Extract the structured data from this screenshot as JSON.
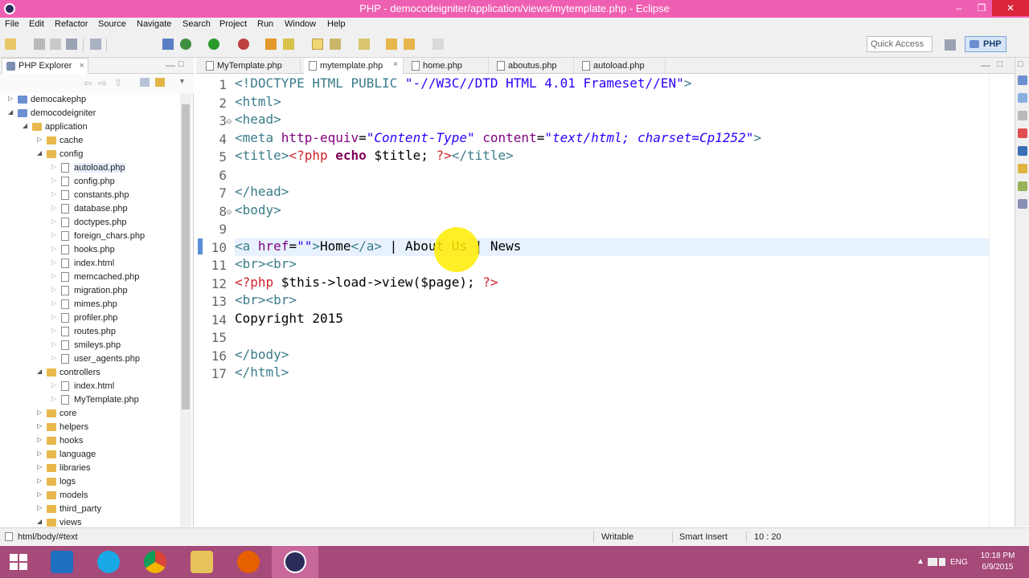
{
  "window": {
    "title": "PHP - democodeigniter/application/views/mytemplate.php - Eclipse"
  },
  "menu": [
    "File",
    "Edit",
    "Refactor",
    "Source",
    "Navigate",
    "Search",
    "Project",
    "Run",
    "Window",
    "Help"
  ],
  "toolbar": {
    "quick_access_placeholder": "Quick Access",
    "perspective": "PHP"
  },
  "explorer": {
    "tab_label": "PHP Explorer",
    "tree": [
      {
        "label": "democakephp",
        "type": "project",
        "depth": 0,
        "expanded": false
      },
      {
        "label": "democodeigniter",
        "type": "project",
        "depth": 0,
        "expanded": true
      },
      {
        "label": "application",
        "type": "folder",
        "depth": 1,
        "expanded": true
      },
      {
        "label": "cache",
        "type": "folder",
        "depth": 2,
        "expanded": false
      },
      {
        "label": "config",
        "type": "folder",
        "depth": 2,
        "expanded": true
      },
      {
        "label": "autoload.php",
        "type": "file",
        "depth": 3,
        "expanded": false
      },
      {
        "label": "config.php",
        "type": "file",
        "depth": 3,
        "expanded": false
      },
      {
        "label": "constants.php",
        "type": "file",
        "depth": 3,
        "expanded": false
      },
      {
        "label": "database.php",
        "type": "file",
        "depth": 3,
        "expanded": false
      },
      {
        "label": "doctypes.php",
        "type": "file",
        "depth": 3,
        "expanded": false
      },
      {
        "label": "foreign_chars.php",
        "type": "file",
        "depth": 3,
        "expanded": false
      },
      {
        "label": "hooks.php",
        "type": "file",
        "depth": 3,
        "expanded": false
      },
      {
        "label": "index.html",
        "type": "file",
        "depth": 3,
        "expanded": false
      },
      {
        "label": "memcached.php",
        "type": "file",
        "depth": 3,
        "expanded": false
      },
      {
        "label": "migration.php",
        "type": "file",
        "depth": 3,
        "expanded": false
      },
      {
        "label": "mimes.php",
        "type": "file",
        "depth": 3,
        "expanded": false
      },
      {
        "label": "profiler.php",
        "type": "file",
        "depth": 3,
        "expanded": false
      },
      {
        "label": "routes.php",
        "type": "file",
        "depth": 3,
        "expanded": false
      },
      {
        "label": "smileys.php",
        "type": "file",
        "depth": 3,
        "expanded": false
      },
      {
        "label": "user_agents.php",
        "type": "file",
        "depth": 3,
        "expanded": false
      },
      {
        "label": "controllers",
        "type": "folder",
        "depth": 2,
        "expanded": true
      },
      {
        "label": "index.html",
        "type": "file",
        "depth": 3,
        "expanded": false
      },
      {
        "label": "MyTemplate.php",
        "type": "file",
        "depth": 3,
        "expanded": false
      },
      {
        "label": "core",
        "type": "folder",
        "depth": 2,
        "expanded": false
      },
      {
        "label": "helpers",
        "type": "folder",
        "depth": 2,
        "expanded": false
      },
      {
        "label": "hooks",
        "type": "folder",
        "depth": 2,
        "expanded": false
      },
      {
        "label": "language",
        "type": "folder",
        "depth": 2,
        "expanded": false
      },
      {
        "label": "libraries",
        "type": "folder",
        "depth": 2,
        "expanded": false
      },
      {
        "label": "logs",
        "type": "folder",
        "depth": 2,
        "expanded": false
      },
      {
        "label": "models",
        "type": "folder",
        "depth": 2,
        "expanded": false
      },
      {
        "label": "third_party",
        "type": "folder",
        "depth": 2,
        "expanded": false
      },
      {
        "label": "views",
        "type": "folder",
        "depth": 2,
        "expanded": true
      }
    ]
  },
  "editor": {
    "tabs": [
      {
        "label": "MyTemplate.php",
        "active": false
      },
      {
        "label": "mytemplate.php",
        "active": true
      },
      {
        "label": "home.php",
        "active": false
      },
      {
        "label": "aboutus.php",
        "active": false
      },
      {
        "label": "autoload.php",
        "active": false
      }
    ],
    "lines": [
      {
        "num": "1",
        "html": "<span class=\"t-tag\">&lt;!DOCTYPE HTML PUBLIC </span><span class=\"t-strn\">\"-//W3C//DTD HTML 4.01 Frameset//EN\"</span><span class=\"t-tag\">&gt;</span>"
      },
      {
        "num": "2",
        "html": "<span class=\"t-tag\">&lt;html&gt;</span>"
      },
      {
        "num": "3",
        "html": "<span class=\"t-tag\">&lt;head&gt;</span>"
      },
      {
        "num": "4",
        "html": "<span class=\"t-tag\">&lt;meta </span><span class=\"t-attr\">http-equiv</span>=<span class=\"t-str\">\"Content-Type\"</span> <span class=\"t-attr\">content</span>=<span class=\"t-str\">\"text/html; charset=Cp1252\"</span><span class=\"t-tag\">&gt;</span>"
      },
      {
        "num": "5",
        "html": "<span class=\"t-tag\">&lt;title&gt;</span><span class=\"t-php\">&lt;?php</span> <span class=\"t-kw\">echo</span> $title; <span class=\"t-php\">?&gt;</span><span class=\"t-tag\">&lt;/title&gt;</span>"
      },
      {
        "num": "6",
        "html": ""
      },
      {
        "num": "7",
        "html": "<span class=\"t-tag\">&lt;/head&gt;</span>"
      },
      {
        "num": "8",
        "html": "<span class=\"t-tag\">&lt;body&gt;</span>"
      },
      {
        "num": "9",
        "html": ""
      },
      {
        "num": "10",
        "html": "<span class=\"t-tag\">&lt;a </span><span class=\"t-attr\">href</span>=<span class=\"t-strn\">\"\"</span><span class=\"t-tag\">&gt;</span>Home<span class=\"t-tag\">&lt;/a&gt;</span> | About Us | News",
        "current": true
      },
      {
        "num": "11",
        "html": "<span class=\"t-tag\">&lt;br&gt;&lt;br&gt;</span>"
      },
      {
        "num": "12",
        "html": "<span class=\"t-php\">&lt;?php</span> $this-&gt;load-&gt;view($page); <span class=\"t-php\">?&gt;</span>"
      },
      {
        "num": "13",
        "html": "<span class=\"t-tag\">&lt;br&gt;&lt;br&gt;</span>"
      },
      {
        "num": "14",
        "html": "Copyright 2015"
      },
      {
        "num": "15",
        "html": ""
      },
      {
        "num": "16",
        "html": "<span class=\"t-tag\">&lt;/body&gt;</span>"
      },
      {
        "num": "17",
        "html": "<span class=\"t-tag\">&lt;/html&gt;</span>"
      }
    ]
  },
  "status": {
    "path": "html/body/#text",
    "mode": "Writable",
    "insert": "Smart Insert",
    "position": "10 : 20"
  },
  "tray": {
    "lang": "ENG",
    "time": "10:18 PM",
    "date": "6/9/2015"
  }
}
